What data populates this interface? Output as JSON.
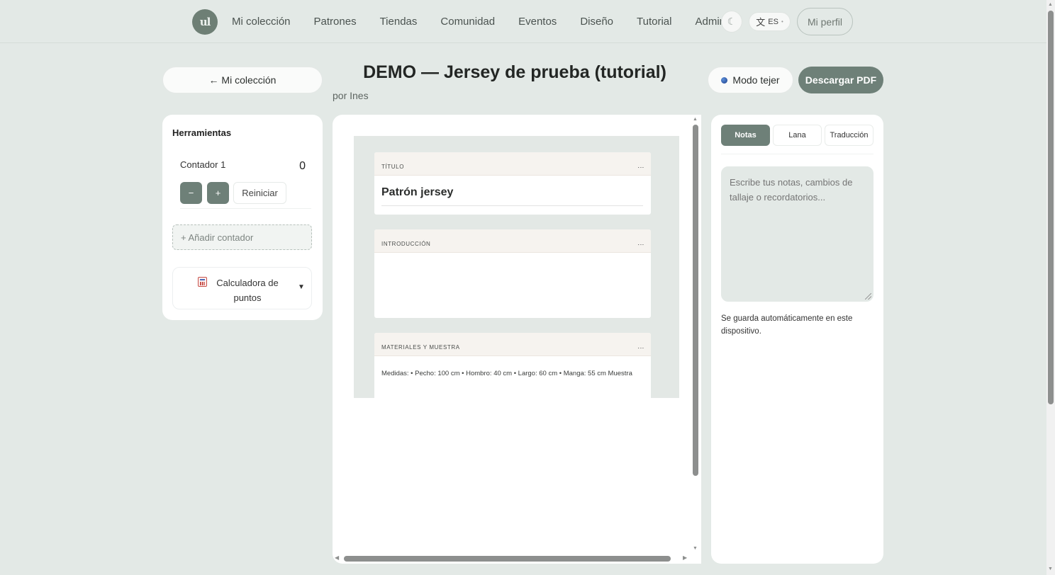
{
  "nav": {
    "logo_text": "ul",
    "links": [
      "Mi colección",
      "Patrones",
      "Tiendas",
      "Comunidad",
      "Eventos",
      "Diseño",
      "Tutorial",
      "Admin"
    ],
    "theme_icon": "☾",
    "lang_glyph": "文",
    "lang_code": "ES",
    "profile_label": "Mi perfil"
  },
  "header": {
    "back_label": "← Mi colección",
    "title": "DEMO — Jersey de prueba (tutorial)",
    "author": "por Ines",
    "knit_mode_label": "Modo tejer",
    "download_label": "Descargar PDF"
  },
  "tools": {
    "title": "Herramientas",
    "counter": {
      "name": "Contador 1",
      "value": "0",
      "minus": "−",
      "plus": "+",
      "reset": "Reiniciar"
    },
    "add_counter": "+ Añadir contador",
    "calculator_label": "Calculadora de puntos",
    "calculator_icon": "abacus-icon",
    "calculator_caret": "▼"
  },
  "pattern": {
    "sections": [
      {
        "label": "Título",
        "content": "Patrón jersey"
      },
      {
        "label": "Introducción",
        "content": ""
      },
      {
        "label": "Materiales y muestra",
        "content": "Medidas: • Pecho: 100 cm • Hombro: 40 cm • Largo: 60 cm • Manga: 55 cm  Muestra"
      }
    ],
    "menu_icon": "⋮"
  },
  "notes_panel": {
    "tabs": [
      "Notas",
      "Lana",
      "Traducción"
    ],
    "active_tab": "Notas",
    "placeholder": "Escribe tus notas, cambios de tallaje o recordatorios...",
    "autosave": "Se guarda automáticamente en este dispositivo."
  },
  "colors": {
    "accent": "#6e8078",
    "background": "#e3e9e6",
    "card": "#ffffff"
  }
}
